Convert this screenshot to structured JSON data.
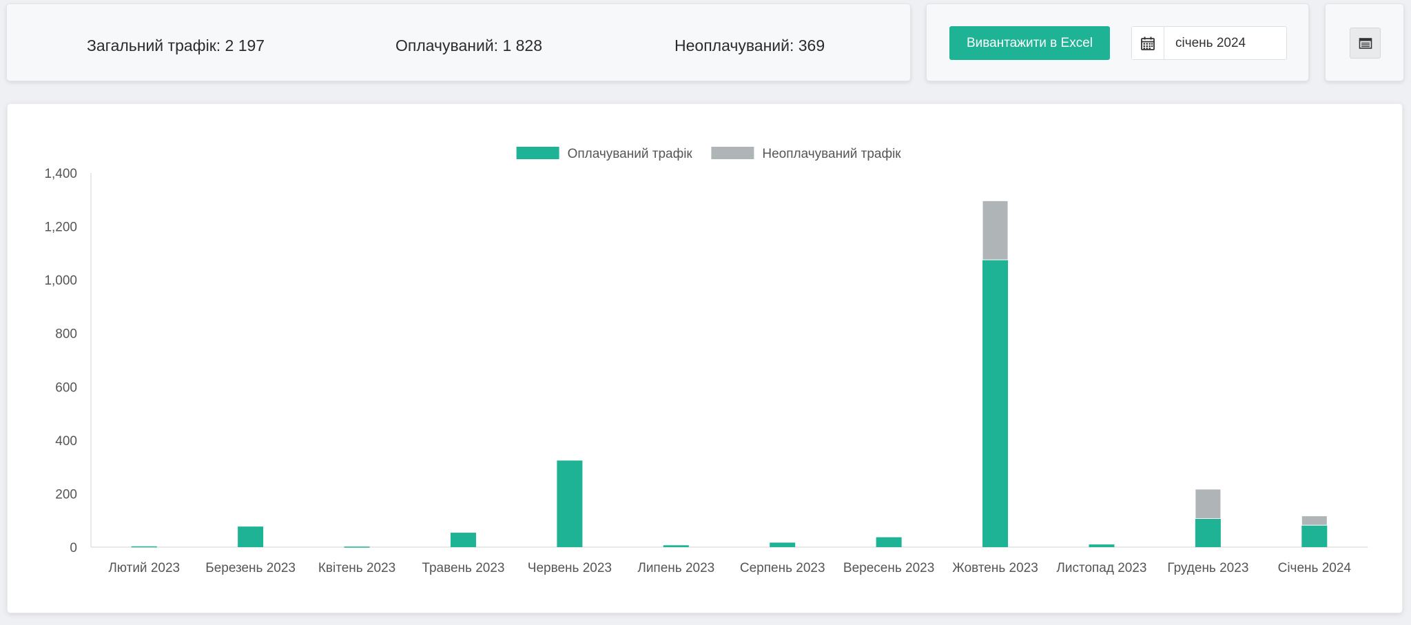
{
  "stats": {
    "total": "Загальний трафік: 2 197",
    "paid": "Оплачуваний: 1 828",
    "unpaid": "Неоплачуваний: 369"
  },
  "actions": {
    "export_label": "Вивантажити в Excel",
    "date_value": "січень 2024"
  },
  "icons": {
    "calendar": "calendar-icon",
    "toggle": "table-view-icon"
  },
  "colors": {
    "accent": "#1eb394",
    "unpaid": "#afb4b7"
  },
  "chart_data": {
    "type": "bar",
    "stacked": true,
    "categories": [
      "Лютий 2023",
      "Березень 2023",
      "Квітень 2023",
      "Травень 2023",
      "Червень 2023",
      "Липень 2023",
      "Серпень 2023",
      "Вересень 2023",
      "Жовтень 2023",
      "Листопад 2023",
      "Грудень 2023",
      "Січень 2024"
    ],
    "series": [
      {
        "name": "Оплачуваний трафік",
        "color": "#1eb394",
        "values": [
          3,
          77,
          2,
          54,
          324,
          7,
          17,
          37,
          1075,
          10,
          107,
          82
        ]
      },
      {
        "name": "Неоплачуваний трафік",
        "color": "#afb4b7",
        "values": [
          0,
          0,
          0,
          0,
          0,
          0,
          0,
          0,
          221,
          0,
          110,
          35
        ]
      }
    ],
    "ylim": [
      0,
      1400
    ],
    "yticks": [
      "0",
      "200",
      "400",
      "600",
      "800",
      "1,000",
      "1,200",
      "1,400"
    ],
    "ytick_values": [
      0,
      200,
      400,
      600,
      800,
      1000,
      1200,
      1400
    ],
    "grid": false,
    "legend_position": "top-center"
  }
}
